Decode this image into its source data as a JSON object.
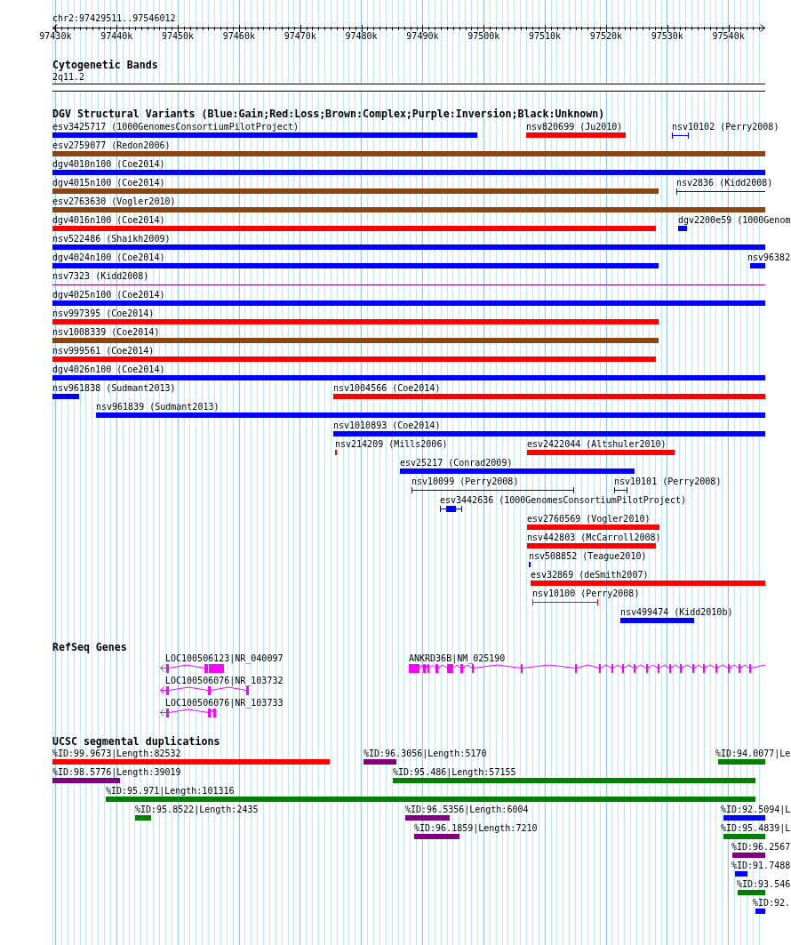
{
  "ruler": {
    "region": "chr2:97429511..97546012",
    "ticks": [
      "97430k",
      "97440k",
      "97450k",
      "97460k",
      "97470k",
      "97480k",
      "97490k",
      "97500k",
      "97510k",
      "97520k",
      "97530k",
      "97540k"
    ]
  },
  "tracks": [
    {
      "kind": "cytoband",
      "title": "Cytogenetic Bands",
      "band": "2q11.2"
    },
    {
      "kind": "variants",
      "title": "DGV Structural Variants (Blue:Gain;Red:Loss;Brown:Complex;Purple:Inversion;Black:Unknown)",
      "rows": [
        {
          "features": [
            {
              "label": "esv3425717 (1000GenomesConsortiumPilotProject)",
              "kind": "bar",
              "color": "#0000ff"
            },
            {
              "label": "nsv820699 (Ju2010)",
              "kind": "bar",
              "color": "#ff0000"
            },
            {
              "label": "nsv10102 (Perry2008)",
              "kind": "span",
              "color": "#0000ff"
            }
          ]
        },
        {
          "features": [
            {
              "label": "esv2759077 (Redon2006)",
              "kind": "bar",
              "color": "#8b4513"
            }
          ]
        },
        {
          "features": [
            {
              "label": "dgv4010n100 (Coe2014)",
              "kind": "bar",
              "color": "#0000ff"
            }
          ]
        },
        {
          "features": [
            {
              "label": "dgv4015n100 (Coe2014)",
              "kind": "bar",
              "color": "#8b4513"
            },
            {
              "label": "nsv2836 (Kidd2008)",
              "kind": "span",
              "color": "#0000ff"
            }
          ]
        },
        {
          "features": [
            {
              "label": "esv2763630 (Vogler2010)",
              "kind": "bar",
              "color": "#8b4513"
            }
          ]
        },
        {
          "features": [
            {
              "label": "dgv4016n100 (Coe2014)",
              "kind": "bar",
              "color": "#ff0000"
            },
            {
              "label": "dgv2200e59 (1000Genom",
              "kind": "bar",
              "color": "#0000ff"
            }
          ]
        },
        {
          "features": [
            {
              "label": "nsv522486 (Shaikh2009)",
              "kind": "bar",
              "color": "#0000ff"
            }
          ]
        },
        {
          "features": [
            {
              "label": "dgv4024n100 (Coe2014)",
              "kind": "bar",
              "color": "#0000ff"
            },
            {
              "label": "nsv96382",
              "kind": "bar",
              "color": "#0000ff"
            }
          ]
        },
        {
          "features": [
            {
              "label": "nsv7323 (Kidd2008)",
              "kind": "span",
              "color": "#800080"
            }
          ]
        },
        {
          "features": [
            {
              "label": "dgv4025n100 (Coe2014)",
              "kind": "bar",
              "color": "#0000ff"
            }
          ]
        },
        {
          "features": [
            {
              "label": "nsv997395 (Coe2014)",
              "kind": "bar",
              "color": "#ff0000"
            }
          ]
        },
        {
          "features": [
            {
              "label": "nsv1008339 (Coe2014)",
              "kind": "bar",
              "color": "#8b4513"
            }
          ]
        },
        {
          "features": [
            {
              "label": "nsv999561 (Coe2014)",
              "kind": "bar",
              "color": "#ff0000"
            }
          ]
        },
        {
          "features": [
            {
              "label": "dgv4026n100 (Coe2014)",
              "kind": "bar",
              "color": "#0000ff"
            }
          ]
        },
        {
          "features": [
            {
              "label": "nsv961838 (Sudmant2013)",
              "kind": "bar",
              "color": "#0000ff"
            },
            {
              "label": "nsv1004566 (Coe2014)",
              "kind": "bar",
              "color": "#ff0000"
            }
          ]
        },
        {
          "features": [
            {
              "label": "nsv961839 (Sudmant2013)",
              "kind": "bar",
              "color": "#0000ff"
            }
          ]
        },
        {
          "features": [
            {
              "label": "nsv1010893 (Coe2014)",
              "kind": "bar",
              "color": "#0000ff"
            }
          ]
        },
        {
          "features": [
            {
              "label": "nsv214209 (Mills2006)",
              "kind": "bar",
              "color": "#ff0000"
            },
            {
              "label": "esv2422044 (Altshuler2010)",
              "kind": "bar",
              "color": "#ff0000"
            }
          ]
        },
        {
          "features": [
            {
              "label": "esv25217 (Conrad2009)",
              "kind": "bar",
              "color": "#0000ff"
            }
          ]
        },
        {
          "features": [
            {
              "label": "nsv10099 (Perry2008)",
              "kind": "span",
              "color": "#0000ff"
            },
            {
              "label": "nsv10101 (Perry2008)",
              "kind": "span",
              "color": "#0000ff"
            }
          ]
        },
        {
          "features": [
            {
              "label": "esv3442636 (1000GenomesConsortiumPilotProject)",
              "kind": "span-core",
              "color": "#0000ff"
            }
          ]
        },
        {
          "features": [
            {
              "label": "esv2760569 (Vogler2010)",
              "kind": "bar",
              "color": "#ff0000"
            }
          ]
        },
        {
          "features": [
            {
              "label": "nsv442803 (McCarroll2008)",
              "kind": "bar",
              "color": "#ff0000"
            }
          ]
        },
        {
          "features": [
            {
              "label": "nsv508852 (Teague2010)",
              "kind": "bar",
              "color": "#0000ff"
            }
          ]
        },
        {
          "features": [
            {
              "label": "esv32869 (deSmith2007)",
              "kind": "bar",
              "color": "#ff0000"
            }
          ]
        },
        {
          "features": [
            {
              "label": "nsv10100 (Perry2008)",
              "kind": "span",
              "color": "#ff0000"
            }
          ]
        },
        {
          "features": [
            {
              "label": "nsv499474 (Kidd2010b)",
              "kind": "bar",
              "color": "#0000ff"
            }
          ]
        }
      ]
    },
    {
      "kind": "genes",
      "title": "RefSeq Genes",
      "rows": [
        {
          "genes": [
            {
              "label": "LOC100506123|NR_040097",
              "minus_strand": true
            },
            {
              "label": "ANKRD36B|NM_025190",
              "minus_strand": false
            }
          ]
        },
        {
          "genes": [
            {
              "label": "LOC100506076|NR_103732",
              "minus_strand": true
            }
          ]
        },
        {
          "genes": [
            {
              "label": "LOC100506076|NR_103733",
              "minus_strand": true
            }
          ]
        }
      ]
    },
    {
      "kind": "duplications",
      "title": "UCSC segmental duplications",
      "rows": [
        {
          "features": [
            {
              "label": "%ID:99.9673|Length:82532",
              "kind": "bar",
              "color": "#ff0000"
            },
            {
              "label": "%ID:96.3056|Length:5170",
              "kind": "bar",
              "color": "#800080"
            },
            {
              "label": "%ID:94.0077|Le",
              "kind": "bar",
              "color": "#008000"
            }
          ]
        },
        {
          "features": [
            {
              "label": "%ID:98.5776|Length:39019",
              "kind": "bar",
              "color": "#800080"
            },
            {
              "label": "%ID:95.486|Length:57155",
              "kind": "bar",
              "color": "#008000"
            }
          ]
        },
        {
          "features": [
            {
              "label": "%ID:95.971|Length:101316",
              "kind": "bar",
              "color": "#008000"
            }
          ]
        },
        {
          "features": [
            {
              "label": "%ID:95.8522|Length:2435",
              "kind": "bar",
              "color": "#008000"
            },
            {
              "label": "%ID:96.5356|Length:6004",
              "kind": "bar",
              "color": "#800080"
            },
            {
              "label": "%ID:92.5094|L",
              "kind": "bar",
              "color": "#0000ff"
            }
          ]
        },
        {
          "features": [
            {
              "label": "%ID:96.1859|Length:7210",
              "kind": "bar",
              "color": "#800080"
            },
            {
              "label": "%ID:95.4839|L",
              "kind": "bar",
              "color": "#008000"
            }
          ]
        },
        {
          "features": [
            {
              "label": "%ID:96.2567",
              "kind": "bar",
              "color": "#800080"
            }
          ]
        },
        {
          "features": [
            {
              "label": "%ID:91.7488",
              "kind": "bar",
              "color": "#0000ff"
            }
          ]
        },
        {
          "features": [
            {
              "label": "%ID:93.546",
              "kind": "bar",
              "color": "#008000"
            }
          ]
        },
        {
          "features": [
            {
              "label": "%ID:92.",
              "kind": "bar",
              "color": "#0000ff"
            }
          ]
        }
      ]
    }
  ]
}
